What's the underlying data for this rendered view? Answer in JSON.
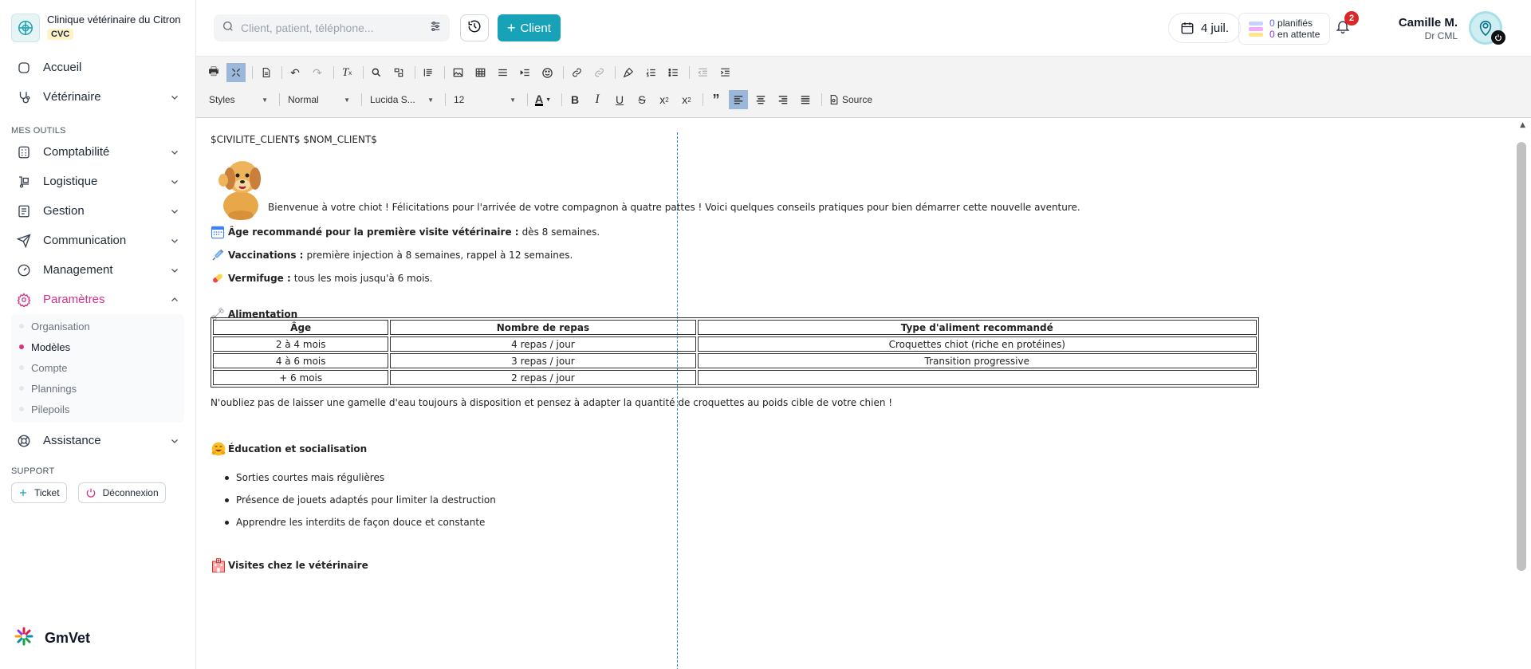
{
  "clinic": {
    "name": "Clinique vétérinaire du Citron",
    "badge": "CVC"
  },
  "sidebar": {
    "top_items": [
      {
        "label": "Accueil"
      },
      {
        "label": "Vétérinaire"
      }
    ],
    "tools_label": "MES OUTILS",
    "tools": [
      {
        "label": "Comptabilité"
      },
      {
        "label": "Logistique"
      },
      {
        "label": "Gestion"
      },
      {
        "label": "Communication"
      },
      {
        "label": "Management"
      },
      {
        "label": "Paramètres"
      }
    ],
    "settings_sub": [
      {
        "label": "Organisation"
      },
      {
        "label": "Modèles"
      },
      {
        "label": "Compte"
      },
      {
        "label": "Plannings"
      },
      {
        "label": "Pilepoils"
      }
    ],
    "assistance": "Assistance",
    "support_label": "SUPPORT",
    "ticket": "Ticket",
    "logout": "Déconnexion",
    "brand": "GmVet"
  },
  "topbar": {
    "search_placeholder": "Client, patient, téléphone...",
    "client_button": "Client",
    "date": "4 juil.",
    "planned_count": "0",
    "planned_label": "planifiés",
    "pending_count": "0",
    "pending_label": "en attente",
    "notifications": "2",
    "user_name": "Camille M.",
    "user_role": "Dr CML"
  },
  "toolbar": {
    "styles": "Styles",
    "format": "Normal",
    "font": "Lucida S...",
    "size": "12",
    "source": "Source"
  },
  "doc": {
    "header_line": "$CIVILITE_CLIENT$ $NOM_CLIENT$",
    "intro": "Bienvenue à votre chiot ! Félicitations pour l'arrivée de votre compagnon à quatre pattes ! Voici quelques conseils pratiques pour bien démarrer cette nouvelle aventure.",
    "items": [
      {
        "bold": "Âge recommandé pour la première visite vétérinaire :",
        "text": "dès 8 semaines."
      },
      {
        "bold": "Vaccinations :",
        "text": "première injection à 8 semaines, rappel à 12 semaines."
      },
      {
        "bold": "Vermifuge :",
        "text": "tous les mois jusqu'à 6 mois."
      }
    ],
    "food_title": "Alimentation",
    "table": {
      "headers": [
        "Âge",
        "Nombre de repas",
        "Type d'aliment recommandé"
      ],
      "rows": [
        [
          "2 à 4 mois",
          "4 repas / jour",
          "Croquettes chiot (riche en protéines)"
        ],
        [
          "4 à 6 mois",
          "3 repas / jour",
          "Transition progressive"
        ],
        [
          "+ 6 mois",
          "2 repas / jour",
          ""
        ]
      ]
    },
    "note": "N'oubliez pas de laisser une gamelle d'eau toujours à disposition et pensez à adapter la quantité de croquettes au poids cible de votre chien !",
    "edu_title": "Éducation et socialisation",
    "edu_items": [
      "Sorties courtes mais régulières",
      "Présence de jouets adaptés pour limiter la destruction",
      "Apprendre les interdits de façon douce et constante"
    ],
    "visit_title": "Visites chez le vétérinaire"
  },
  "colors": {
    "accent": "#17a2b8",
    "active": "#d63384",
    "badge": "#dc2626"
  }
}
